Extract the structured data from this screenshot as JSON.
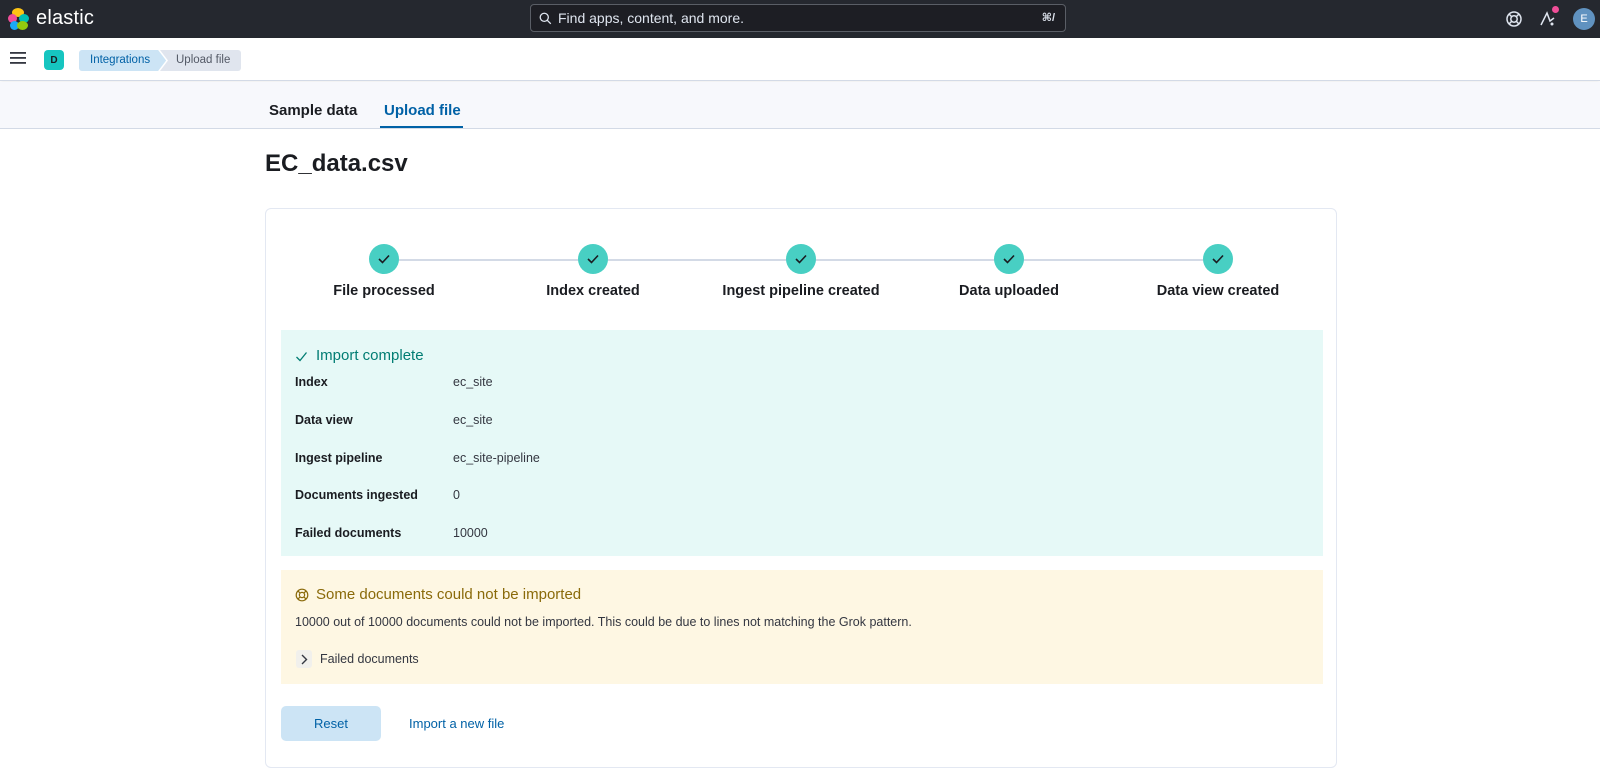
{
  "header": {
    "brand": "elastic",
    "search_placeholder": "Find apps, content, and more.",
    "search_shortcut": "⌘/",
    "avatar_initial": "E"
  },
  "subheader": {
    "space_initial": "D",
    "breadcrumbs": [
      "Integrations",
      "Upload file"
    ]
  },
  "tabs": [
    {
      "label": "Sample data",
      "active": false
    },
    {
      "label": "Upload file",
      "active": true
    }
  ],
  "page_title": "EC_data.csv",
  "steps": [
    {
      "label": "File processed",
      "done": true
    },
    {
      "label": "Index created",
      "done": true
    },
    {
      "label": "Ingest pipeline created",
      "done": true
    },
    {
      "label": "Data uploaded",
      "done": true
    },
    {
      "label": "Data view created",
      "done": true
    }
  ],
  "import_result": {
    "title": "Import complete",
    "rows": [
      {
        "key": "Index",
        "value": "ec_site"
      },
      {
        "key": "Data view",
        "value": "ec_site"
      },
      {
        "key": "Ingest pipeline",
        "value": "ec_site-pipeline"
      },
      {
        "key": "Documents ingested",
        "value": "0"
      },
      {
        "key": "Failed documents",
        "value": "10000"
      }
    ]
  },
  "warning": {
    "title": "Some documents could not be imported",
    "message": "10000 out of 10000 documents could not be imported. This could be due to lines not matching the Grok pattern.",
    "toggle_label": "Failed documents"
  },
  "actions": {
    "reset_label": "Reset",
    "import_new_label": "Import a new file"
  },
  "colors": {
    "accent": "#0061a6",
    "success_bg": "#e6f9f7",
    "warning_bg": "#fef7e3",
    "step_done": "#48cfc3"
  }
}
